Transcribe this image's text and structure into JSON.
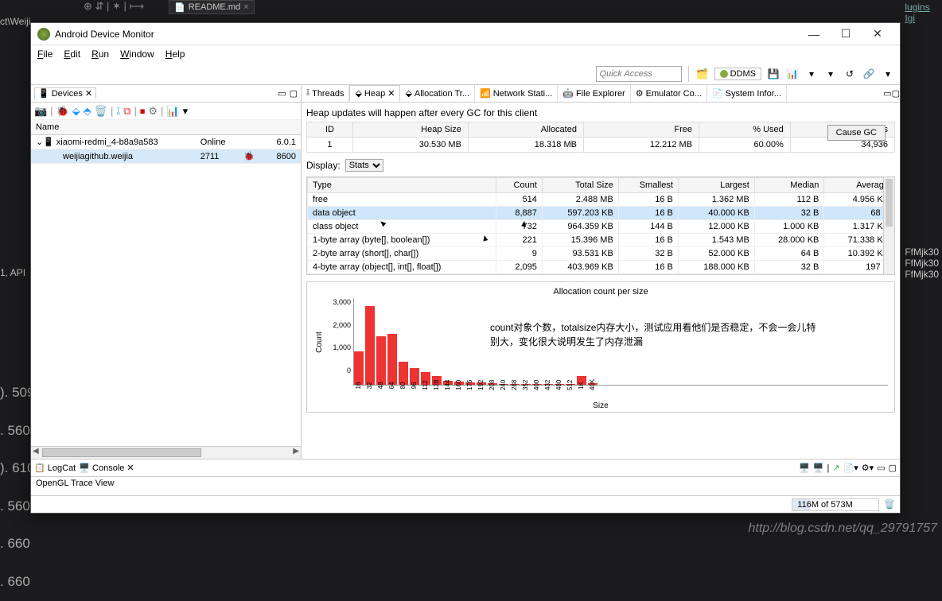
{
  "bg": {
    "tab_name": "README.md",
    "proj_frag": "ct\\Weiji...",
    "api_frag": "1, API",
    "right_hints": [
      "lugins",
      "Igi",
      "FfMjk30",
      "FfMjk30",
      "FfMjk30"
    ],
    "numbers": [
      "). 509",
      ". 560",
      "). 610",
      ". 560",
      ". 660",
      ". 660"
    ]
  },
  "window": {
    "title": "Android Device Monitor",
    "menu": [
      "File",
      "Edit",
      "Run",
      "Window",
      "Help"
    ],
    "quick_access_ph": "Quick Access",
    "perspective": "DDMS"
  },
  "devices": {
    "title": "Devices",
    "columns": [
      "Name",
      "",
      "",
      ""
    ],
    "rows": [
      {
        "name": "xiaomi-redmi_4-b8a9a583",
        "c2": "Online",
        "c3": "",
        "c4": "6.0.1"
      },
      {
        "name": "weijiagithub.weijia",
        "c2": "2711",
        "c3": "",
        "c4": "8600"
      }
    ]
  },
  "heap": {
    "tabs": [
      "Threads",
      "Heap",
      "Allocation Tr...",
      "Network Stati...",
      "File Explorer",
      "Emulator Co...",
      "System Infor..."
    ],
    "info": "Heap updates will happen after every GC for this client",
    "summary_headers": [
      "ID",
      "Heap Size",
      "Allocated",
      "Free",
      "% Used",
      "# Objects"
    ],
    "summary_row": [
      "1",
      "30.530 MB",
      "18.318 MB",
      "12.212 MB",
      "60.00%",
      "34,936"
    ],
    "cause_gc": "Cause GC",
    "display_lbl": "Display:",
    "display_sel": "Stats",
    "type_headers": [
      "Type",
      "Count",
      "Total Size",
      "Smallest",
      "Largest",
      "Median",
      "Average"
    ],
    "type_rows": [
      {
        "t": "free",
        "c": "514",
        "ts": "2.488 MB",
        "sm": "16 B",
        "lg": "1.362 MB",
        "md": "112 B",
        "av": "4.956 KB"
      },
      {
        "t": "data object",
        "c": "8,887",
        "ts": "597.203 KB",
        "sm": "16 B",
        "lg": "40.000 KB",
        "md": "32 B",
        "av": "68 B",
        "hi": true
      },
      {
        "t": "class object",
        "c": "732",
        "ts": "964.359 KB",
        "sm": "144 B",
        "lg": "12.000 KB",
        "md": "1.000 KB",
        "av": "1.317 KB"
      },
      {
        "t": "1-byte array (byte[], boolean[])",
        "c": "221",
        "ts": "15.396 MB",
        "sm": "16 B",
        "lg": "1.543 MB",
        "md": "28.000 KB",
        "av": "71.338 KB"
      },
      {
        "t": "2-byte array (short[], char[])",
        "c": "9",
        "ts": "93.531 KB",
        "sm": "32 B",
        "lg": "52.000 KB",
        "md": "64 B",
        "av": "10.392 KB"
      },
      {
        "t": "4-byte array (object[], int[], float[])",
        "c": "2,095",
        "ts": "403.969 KB",
        "sm": "16 B",
        "lg": "188.000 KB",
        "md": "32 B",
        "av": "197 B"
      }
    ]
  },
  "annotation": "count对象个数，totalsize内存大小，测试应用看他们是否稳定，不会一会儿特别大，变化很大说明发生了内存泄漏",
  "chart_data": {
    "type": "bar",
    "title": "Allocation count per size",
    "xlabel": "Size",
    "ylabel": "Count",
    "ylim": [
      0,
      3000
    ],
    "y_ticks": [
      "3,000",
      "2,000",
      "1,000",
      "0"
    ],
    "categories": [
      "16",
      "32",
      "48",
      "64",
      "80",
      "96",
      "112",
      "128",
      "144",
      "160",
      "176",
      "192",
      "208",
      "240",
      "288",
      "352",
      "400",
      "432",
      "480",
      "512",
      "1K",
      "40K"
    ],
    "values": [
      1300,
      3100,
      1900,
      2000,
      900,
      650,
      500,
      350,
      150,
      120,
      100,
      80,
      60,
      40,
      30,
      20,
      20,
      10,
      10,
      10,
      350,
      60
    ]
  },
  "bottom": {
    "tabs": [
      "LogCat",
      "Console"
    ],
    "body": "OpenGL Trace View"
  },
  "status": {
    "mem": "116M of 573M"
  },
  "watermark": "http://blog.csdn.net/qq_29791757"
}
